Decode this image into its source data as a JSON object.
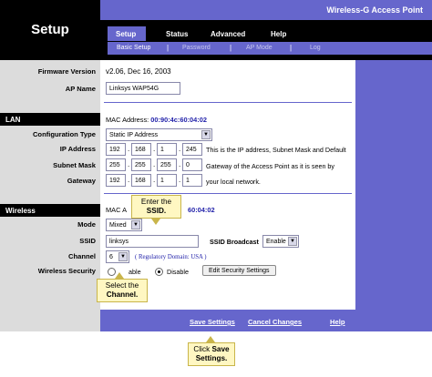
{
  "header": {
    "title": "Setup",
    "product": "Wireless-G Access Point",
    "tabs": [
      "Setup",
      "Status",
      "Advanced",
      "Help"
    ],
    "subtabs": [
      "Basic Setup",
      "Password",
      "AP Mode",
      "Log"
    ],
    "separator": "|"
  },
  "sections": {
    "lan": "LAN",
    "wireless": "Wireless"
  },
  "labels": {
    "firmware": "Firmware Version",
    "ap_name": "AP Name",
    "config_type": "Configuration Type",
    "ip": "IP Address",
    "subnet": "Subnet Mask",
    "gateway": "Gateway",
    "mode": "Mode",
    "ssid": "SSID",
    "channel": "Channel",
    "security": "Wireless Security"
  },
  "values": {
    "firmware": "v2.06, Dec 16, 2003",
    "ap_name": "Linksys WAP54G",
    "lan_mac_label": "MAC Address:",
    "lan_mac": "00:90:4c:60:04:02",
    "config_type": "Static IP Address",
    "ip": [
      "192",
      "168",
      "1",
      "245"
    ],
    "subnet": [
      "255",
      "255",
      "255",
      "0"
    ],
    "gateway": [
      "192",
      "168",
      "1",
      "1"
    ],
    "ip_note_1": "This is the IP address, Subnet Mask and Default",
    "ip_note_2": "Gateway of the Access Point as it is seen by",
    "ip_note_3": "your local network.",
    "wl_mac_prefix": "MAC A",
    "wl_mac_suffix": "60:04:02",
    "mode": "Mixed",
    "ssid": "linksys",
    "ssid_broadcast_label": "SSID Broadcast",
    "ssid_broadcast": "Enable",
    "channel": "6",
    "regulatory": "( Regulatory Domain: USA )",
    "security_enable_partial": "able",
    "security_disable": "Disable",
    "edit_security": "Edit Security Settings"
  },
  "footer": {
    "save": "Save Settings",
    "cancel": "Cancel Changes",
    "help": "Help"
  },
  "callouts": {
    "ssid_l1": "Enter the",
    "ssid_l2": "SSID.",
    "channel_l1": "Select the",
    "channel_l2": "Channel.",
    "save_l1": "Click",
    "save_l1b": "Save",
    "save_l2": "Settings."
  },
  "colors": {
    "accent": "#6666cc",
    "header": "#000000",
    "sidebar": "#dcdcdc",
    "callout": "#fff7c2"
  }
}
